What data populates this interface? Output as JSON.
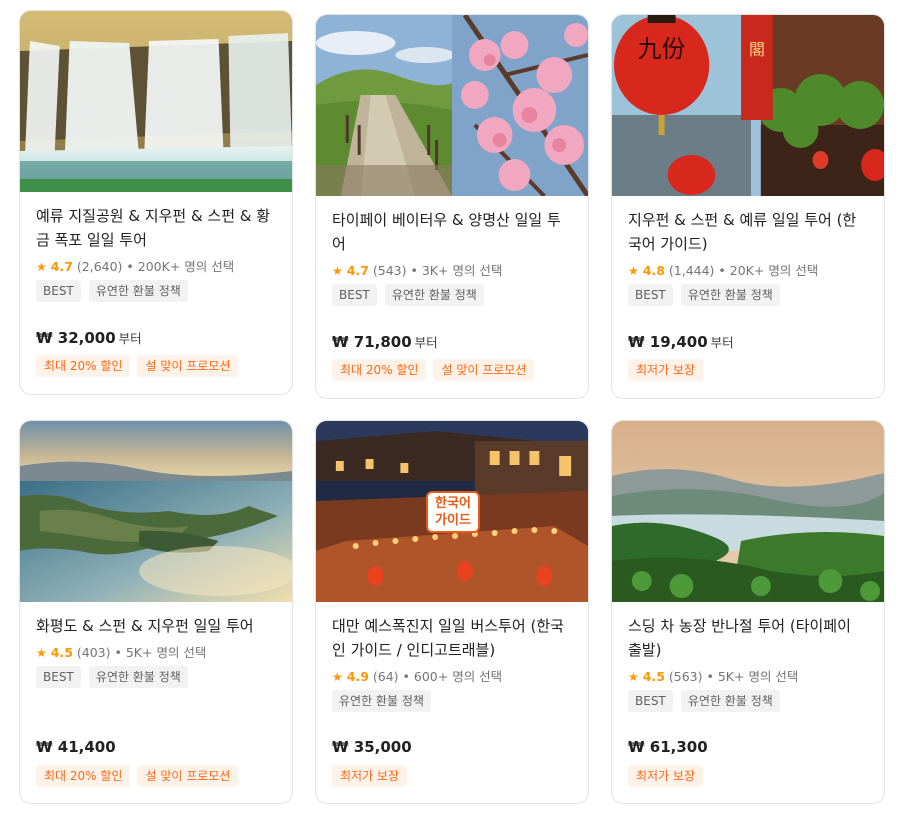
{
  "currency_symbol": "₩",
  "accent_color": "#ff6a1a",
  "star_color": "#ff9800",
  "cards": [
    {
      "title": "예류 지질공원 & 지우펀 & 스펀 & 황금 폭포 일일 투어",
      "rating": "4.7",
      "reviews": "(2,640)",
      "booked": "• 200K+ 명의 선택",
      "tags": [
        "BEST",
        "유연한 환불 정책"
      ],
      "price": "₩ 32,000",
      "price_suffix": "부터",
      "badges": [
        "최대 20% 할인",
        "설 맞이 프로모션"
      ],
      "image": "waterfall"
    },
    {
      "title": "타이페이 베이터우 & 양명산 일일 투어",
      "rating": "4.7",
      "reviews": "(543)",
      "booked": "• 3K+ 명의 선택",
      "tags": [
        "BEST",
        "유연한 환불 정책"
      ],
      "price": "₩ 71,800",
      "price_suffix": "부터",
      "badges": [
        "최대 20% 할인",
        "설 맞이 프로모션"
      ],
      "image": "mountain-blossom"
    },
    {
      "title": "지우펀 & 스펀 & 예류 일일 투어 (한국어 가이드)",
      "rating": "4.8",
      "reviews": "(1,444)",
      "booked": "• 20K+ 명의 선택",
      "tags": [
        "BEST",
        "유연한 환불 정책"
      ],
      "price": "₩ 19,400",
      "price_suffix": "부터",
      "badges": [
        "최저가 보장"
      ],
      "image": "lanterns",
      "lantern_text": "九份"
    },
    {
      "title": "화평도 & 스펀 & 지우펀 일일 투어",
      "rating": "4.5",
      "reviews": "(403)",
      "booked": "• 5K+ 명의 선택",
      "tags": [
        "BEST",
        "유연한 환불 정책"
      ],
      "price": "₩ 41,400",
      "price_suffix": "",
      "badges": [
        "최대 20% 할인",
        "설 맞이 프로모션"
      ],
      "image": "coast"
    },
    {
      "title": "대만 예스폭진지 일일 버스투어 (한국인 가이드 / 인디고트래블)",
      "rating": "4.9",
      "reviews": "(64)",
      "booked": "• 600+ 명의 선택",
      "tags": [
        "유연한 환불 정책"
      ],
      "price": "₩ 35,000",
      "price_suffix": "",
      "badges": [
        "최저가 보장"
      ],
      "image": "night-town",
      "overlay_label_1": "한국어",
      "overlay_label_2": "가이드"
    },
    {
      "title": "스딩 차 농장 반나절 투어 (타이페이 출발)",
      "rating": "4.5",
      "reviews": "(563)",
      "booked": "• 5K+ 명의 선택",
      "tags": [
        "BEST",
        "유연한 환불 정책"
      ],
      "price": "₩ 61,300",
      "price_suffix": "",
      "badges": [
        "최저가 보장"
      ],
      "image": "lake-hills"
    }
  ]
}
